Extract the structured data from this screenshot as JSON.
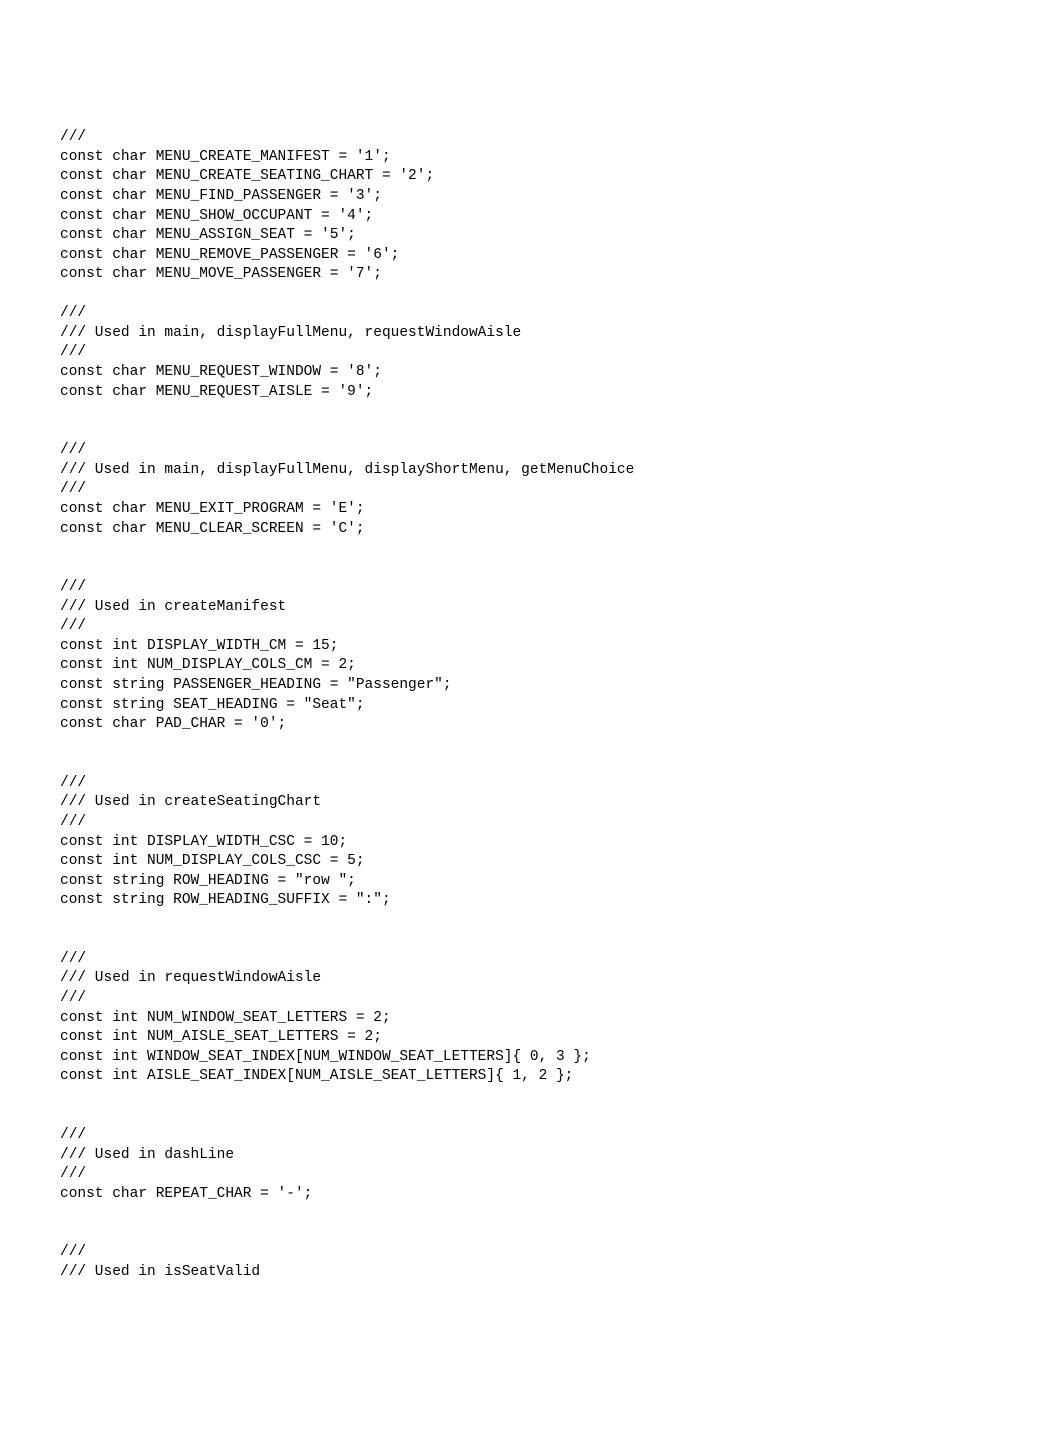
{
  "lines": [
    "///",
    "const char MENU_CREATE_MANIFEST = '1';",
    "const char MENU_CREATE_SEATING_CHART = '2';",
    "const char MENU_FIND_PASSENGER = '3';",
    "const char MENU_SHOW_OCCUPANT = '4';",
    "const char MENU_ASSIGN_SEAT = '5';",
    "const char MENU_REMOVE_PASSENGER = '6';",
    "const char MENU_MOVE_PASSENGER = '7';",
    "",
    "///",
    "/// Used in main, displayFullMenu, requestWindowAisle",
    "///",
    "const char MENU_REQUEST_WINDOW = '8';",
    "const char MENU_REQUEST_AISLE = '9';",
    "",
    "",
    "///",
    "/// Used in main, displayFullMenu, displayShortMenu, getMenuChoice",
    "///",
    "const char MENU_EXIT_PROGRAM = 'E';",
    "const char MENU_CLEAR_SCREEN = 'C';",
    "",
    "",
    "///",
    "/// Used in createManifest",
    "///",
    "const int DISPLAY_WIDTH_CM = 15;",
    "const int NUM_DISPLAY_COLS_CM = 2;",
    "const string PASSENGER_HEADING = \"Passenger\";",
    "const string SEAT_HEADING = \"Seat\";",
    "const char PAD_CHAR = '0';",
    "",
    "",
    "///",
    "/// Used in createSeatingChart",
    "///",
    "const int DISPLAY_WIDTH_CSC = 10;",
    "const int NUM_DISPLAY_COLS_CSC = 5;",
    "const string ROW_HEADING = \"row \";",
    "const string ROW_HEADING_SUFFIX = \":\";",
    "",
    "",
    "///",
    "/// Used in requestWindowAisle",
    "///",
    "const int NUM_WINDOW_SEAT_LETTERS = 2;",
    "const int NUM_AISLE_SEAT_LETTERS = 2;",
    "const int WINDOW_SEAT_INDEX[NUM_WINDOW_SEAT_LETTERS]{ 0, 3 };",
    "const int AISLE_SEAT_INDEX[NUM_AISLE_SEAT_LETTERS]{ 1, 2 };",
    "",
    "",
    "///",
    "/// Used in dashLine",
    "///",
    "const char REPEAT_CHAR = '-';",
    "",
    "",
    "///",
    "/// Used in isSeatValid"
  ]
}
